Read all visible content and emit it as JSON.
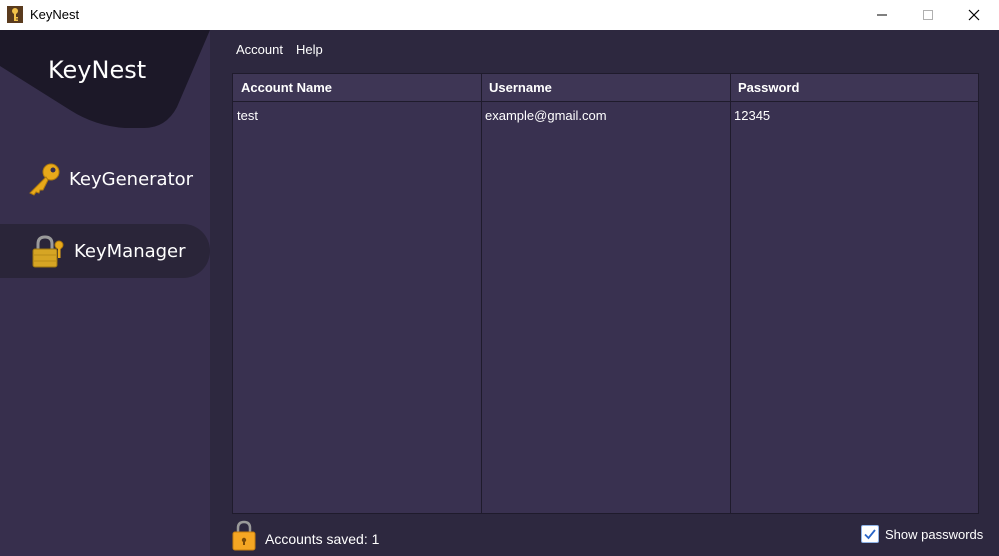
{
  "window": {
    "title": "KeyNest",
    "controls": [
      "minimize-icon",
      "maximize-icon",
      "close-icon"
    ]
  },
  "sidebar": {
    "logo": "KeyNest",
    "items": [
      {
        "label": "KeyGenerator",
        "icon": "key-icon",
        "active": false
      },
      {
        "label": "KeyManager",
        "icon": "padlock-key-icon",
        "active": true
      }
    ]
  },
  "menu": {
    "items": [
      "Account",
      "Help"
    ]
  },
  "table": {
    "columns": [
      "Account Name",
      "Username",
      "Password"
    ],
    "rows": [
      [
        "test",
        "example@gmail.com",
        "12345"
      ]
    ]
  },
  "status": {
    "icon": "lock-icon",
    "text": "Accounts saved: 1"
  },
  "show_passwords": {
    "label": "Show passwords",
    "checked": true
  },
  "colors": {
    "sidebar": "#372f4d",
    "main_bg": "#2d283f",
    "table_bg": "#393150",
    "active_item": "#2a2539",
    "logo_bg": "#1c1828",
    "key_gold": "#e8a91a"
  }
}
